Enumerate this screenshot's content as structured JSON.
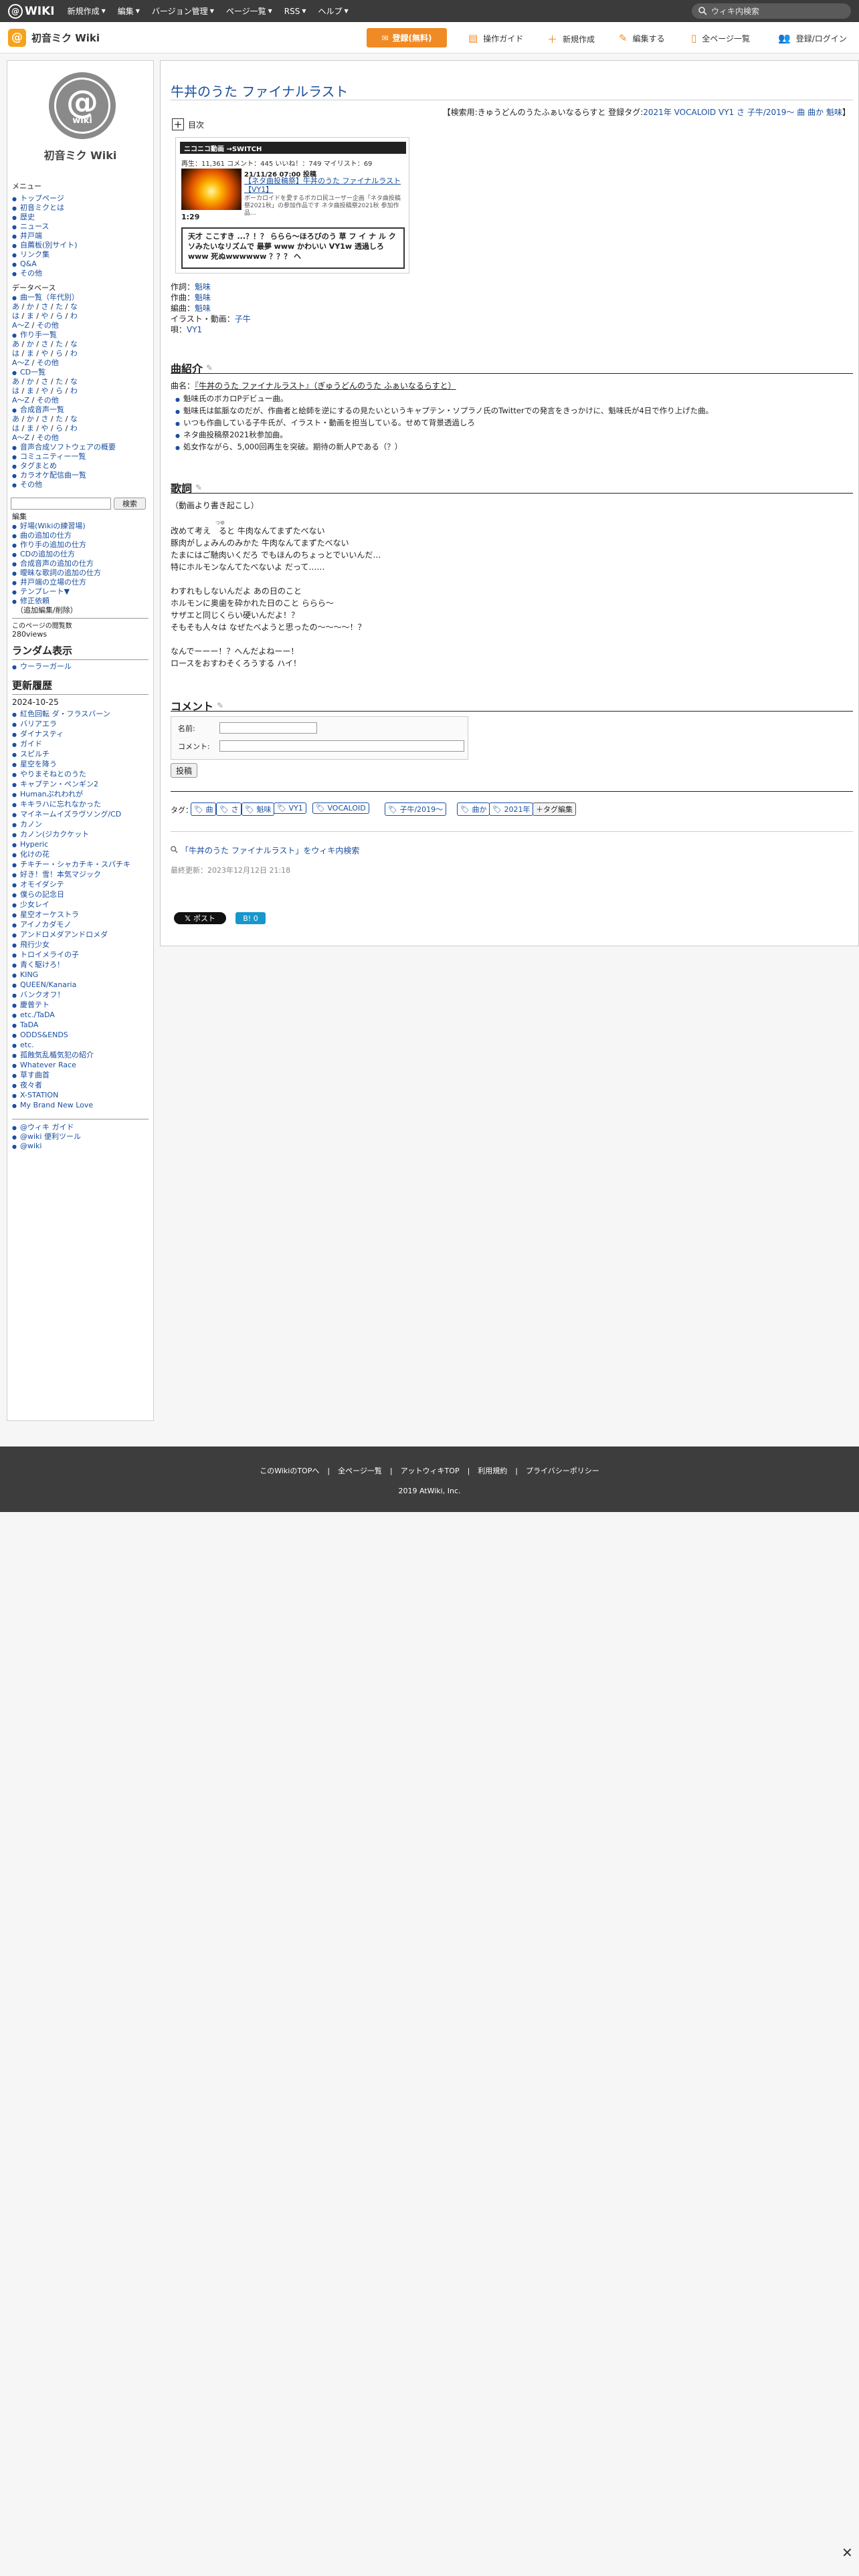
{
  "topbar": {
    "brand": "WIKI",
    "nav": [
      "新規作成",
      "編集",
      "バージョン管理",
      "ページ一覧",
      "RSS",
      "ヘルプ"
    ],
    "search_placeholder": "ウィキ内検索"
  },
  "header": {
    "wiki_name": "初音ミク Wiki",
    "register_button": "登録(無料)",
    "actions": [
      "操作ガイド",
      "新規作成",
      "編集する",
      "全ページ一覧",
      "登録/ログイン"
    ]
  },
  "sidebar": {
    "logo_text": "wiki",
    "title": "初音ミク Wiki",
    "menu_heading": "メニュー",
    "menu": [
      "トップページ",
      "初音ミクとは",
      "歴史",
      "ニュース",
      "井戸端",
      "自薦板(別サイト)",
      "リンク集",
      "Q&A",
      "その他"
    ],
    "db_heading": "データベース",
    "db_song_list": "曲一覧（年代別）",
    "kana_rows": [
      [
        "あ",
        "か",
        "さ",
        "た",
        "な"
      ],
      [
        "は",
        "ま",
        "や",
        "ら",
        "わ"
      ]
    ],
    "az": "A〜Z",
    "other": "その他",
    "db_producers": "作り手一覧",
    "db_cds": "CD一覧",
    "db_synth": "合成音声一覧",
    "db_more": [
      "音声合成ソフトウェアの概要",
      "コミュニティー一覧",
      "タグまとめ",
      "カラオケ配信曲一覧",
      "その他"
    ],
    "search_button": "検索",
    "edit_heading": "編集",
    "edit": [
      "好場(Wikiの練習場)",
      "曲の追加の仕方",
      "作り手の追加の仕方",
      "CDの追加の仕方",
      "合成音声の追加の仕方",
      "曖昧な歌詞の追加の仕方",
      "井戸端の立場の仕方",
      "テンプレート▼",
      "修正依頼"
    ],
    "edit_note": "（追加編集/削除）",
    "views": "このページの閲覧数",
    "views_count": "280views",
    "random_heading": "ランダム表示",
    "random": [
      "ウーラーガール"
    ],
    "updates_heading": "更新履歴",
    "updates_date": "2024-10-25",
    "updates": [
      "紅色回転 ダ・フラスバーン",
      "バリアエラ",
      "ダイナスティ",
      "ガイド",
      "スピルチ",
      "星空を降う",
      "やりまそねとのうた",
      "キャプテン・ペンギン2",
      "Humanぷれわれが",
      "キキラハに忘れなかった",
      "マイネームイズラヴソング/CD",
      "カノン",
      "カノン(ジカクケット",
      "Hyperic",
      "化けの花",
      "チキチー・シャカチキ・スパチキ",
      "好き！雪！本気マジック",
      "オモイダシテ",
      "僕らの記念日",
      "少女レイ",
      "星空オーケストラ",
      "アイノカダモノ",
      "アンドロメダアンドロメダ",
      "飛行少女",
      "トロイメライの子",
      "青く駆けろ！",
      "KING",
      "QUEEN/Kanaria",
      "バンクオフ！",
      "慶曾テト",
      "etc./TaDA",
      "TaDA",
      "ODDS&ENDS",
      "etc.",
      "孤蝕気乱楯気犯の紹介",
      "Whatever Race",
      "草す曲首",
      "夜々者",
      "X-STATION",
      "My Brand New Love"
    ],
    "footer_links": [
      "@ウィキ ガイド",
      "@wiki 便利ツール",
      "@wiki"
    ]
  },
  "page": {
    "title": "牛丼のうた ファイナルラスト",
    "search_tag_prefix": "【検索用:",
    "search_tag_text": "きゅうどんのうたふぁいなるらすと",
    "reg_tags_label": "登録タグ:",
    "reg_tags": [
      "2021年",
      "VOCALOID",
      "VY1",
      "さ",
      "子牛/2019〜",
      "曲",
      "曲か",
      "魁味"
    ],
    "search_tag_suffix": "】",
    "toc_label": "目次",
    "video": {
      "header": "ニコニコ動画 →SWITCH",
      "stats": "再生：11,361 コメント：445 いいね！：749 マイリスト：69",
      "date": "21/11/26 07:00 投稿",
      "title": "【ネタ曲投稿祭】牛丼のうた ファイナルラスト【VY1】",
      "desc": "ボーカロイドを愛するボカロ民ユーザー企画「ネタ曲投稿祭2021秋」の参加作品です ネタ曲投稿祭2021秋 参加作品...",
      "duration": "1:29",
      "comment": "天才 ここすき ...？！？ ららら〜ほろびのう 草 フ イ ナ ル クソみたいなリズムで 最夢 www かわいい VY1w 透過しろwww 死ぬwwwwww ？？？ ヘ"
    },
    "credits": [
      {
        "label": "作詞：",
        "value": "魁味"
      },
      {
        "label": "作曲：",
        "value": "魁味"
      },
      {
        "label": "編曲：",
        "value": "魁味"
      },
      {
        "label": "イラスト・動画：",
        "value": "子牛"
      },
      {
        "label": "唄：",
        "value": "VY1"
      }
    ],
    "intro_heading": "曲紹介",
    "song_name_label": "曲名：",
    "song_name": "『牛丼のうた ファイナルラスト』",
    "song_reading": "（ぎゅうどんのうた ふぁいなるらすと）",
    "intro_bullets": [
      "魁味氏のボカロPデビュー曲。",
      "魁味氏は鉱脈なのだが、作曲者と絵師を逆にするの見たいというキャプテン・ソプラノ氏のTwitterでの発言をきっかけに、魁味氏が4日で作り上げた曲。",
      "いつも作曲している子牛氏が、イラスト・動画を担当している。せめて背景透過しろ",
      "ネタ曲投稿祭2021秋参加曲。",
      "処女作ながら、5,000回再生を突破。期待の新人Pである（？）"
    ],
    "lyrics_heading": "歌詞",
    "lyrics_note": "（動画より書き起こし）",
    "lyrics_ruby": "つゆ",
    "lyrics": [
      "改めて考え　ると 牛肉なんてまずたべない",
      "豚肉がしょみんのみかた 牛肉なんてまずたべない",
      "たまにはご馳肉いくだろ でもほんのちょっとでいいんだ…",
      "特にホルモンなんてたべないよ だって……",
      "",
      "わすれもしないんだよ あの日のこと",
      "ホルモンに奥歯を砕かれた日のこと ららら〜",
      "サザエと同じくらい硬いんだよ！？",
      "そもそも人々は なぜたべようと思ったの〜〜〜〜！？",
      "",
      "なんでーーー！？へんだよねーー！",
      "ロースをおすわそくろうする ハイ！"
    ],
    "comment_heading": "コメント",
    "name_label": "名前:",
    "comment_label": "コメント:",
    "post_button": "投稿",
    "tags_label": "タグ：",
    "tags": [
      "曲",
      "さ",
      "魁味",
      "VY1",
      "VOCALOID",
      "子牛/2019〜",
      "曲か",
      "2021年"
    ],
    "tag_edit": "タグ編集",
    "wiki_search": "「牛丼のうた ファイナルラスト」をウィキ内検索",
    "last_updated": "最終更新：2023年12月12日 21:18",
    "post_x": "ポスト",
    "hatena": "B! 0"
  },
  "footer": {
    "links": [
      "このWikiのTOPへ",
      "全ページ一覧",
      "アットウィキTOP",
      "利用規約",
      "プライバシーポリシー"
    ],
    "copyright": "2019 AtWiki, Inc."
  }
}
